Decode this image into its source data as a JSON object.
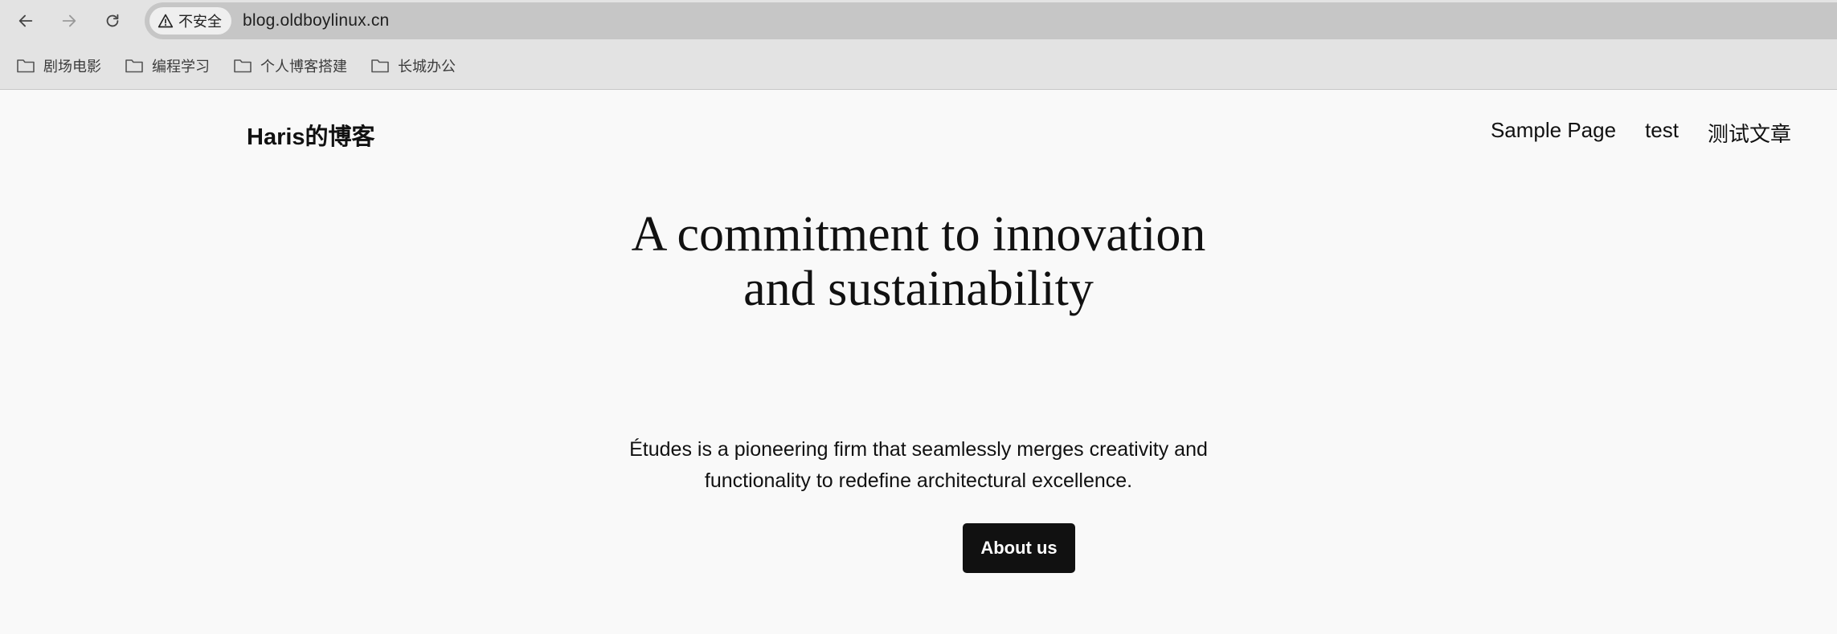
{
  "browser": {
    "security_label": "不安全",
    "url": "blog.oldboylinux.cn",
    "icons": {
      "back": "back-arrow-icon",
      "forward": "forward-arrow-icon",
      "reload": "reload-icon",
      "warning": "warning-triangle-icon"
    }
  },
  "bookmarks": [
    {
      "label": "剧场电影"
    },
    {
      "label": "编程学习"
    },
    {
      "label": "个人博客搭建"
    },
    {
      "label": "长城办公"
    }
  ],
  "site": {
    "title": "Haris的博客",
    "nav": [
      "Sample Page",
      "test",
      "测试文章"
    ]
  },
  "hero": {
    "heading_line1": "A commitment to innovation",
    "heading_line2": "and sustainability",
    "text_line1": "Études is a pioneering firm that seamlessly merges creativity and",
    "text_line2": "functionality to redefine architectural excellence.",
    "button_label": "About us"
  },
  "colors": {
    "page_bg": "#f9f9f9",
    "toolbar_bg": "#e3e3e3",
    "omnibox_bg": "#c6c6c6",
    "button_bg": "#111111",
    "button_text": "#ffffff"
  }
}
